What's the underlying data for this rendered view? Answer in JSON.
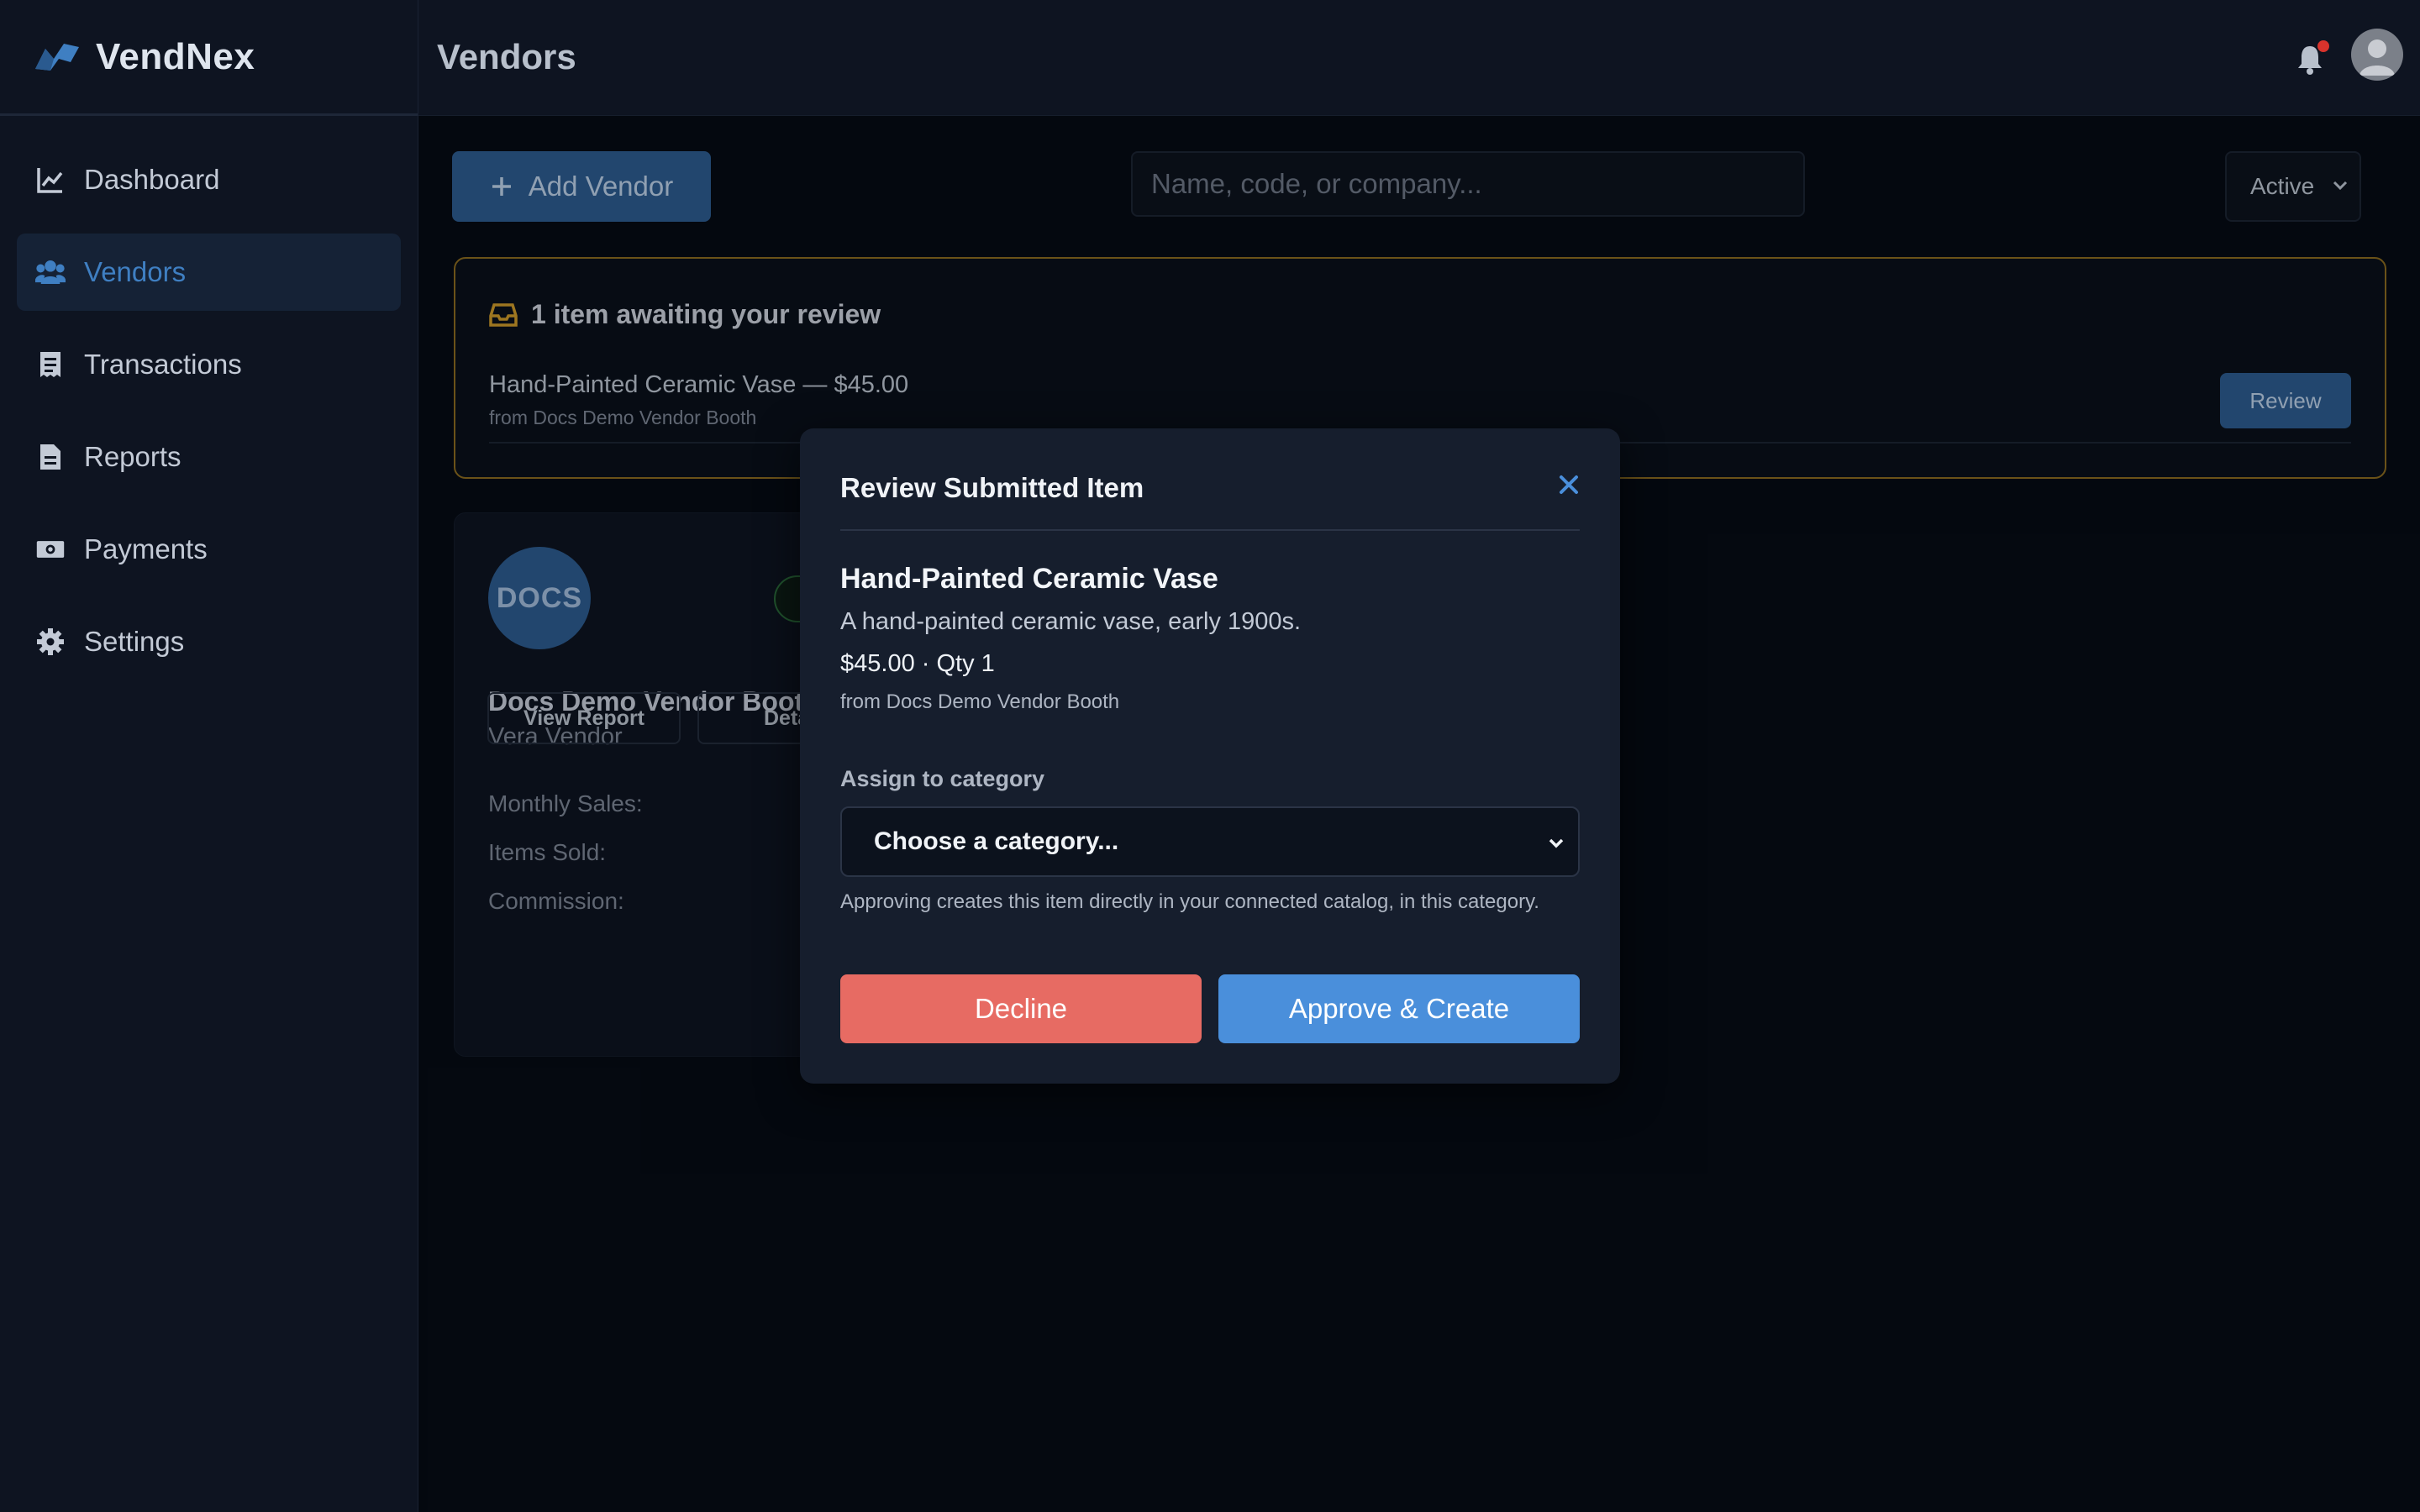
{
  "app": {
    "name": "VendNex"
  },
  "header": {
    "title": "Vendors"
  },
  "sidebar": {
    "items": [
      {
        "label": "Dashboard",
        "icon": "chart-line-icon",
        "active": false
      },
      {
        "label": "Vendors",
        "icon": "users-icon",
        "active": true
      },
      {
        "label": "Transactions",
        "icon": "receipt-icon",
        "active": false
      },
      {
        "label": "Reports",
        "icon": "document-icon",
        "active": false
      },
      {
        "label": "Payments",
        "icon": "money-icon",
        "active": false
      },
      {
        "label": "Settings",
        "icon": "gear-icon",
        "active": false
      }
    ]
  },
  "toolbar": {
    "add_label": "Add Vendor",
    "search_placeholder": "Name, code, or company...",
    "status_value": "Active"
  },
  "review_panel": {
    "heading": "1 item awaiting your review",
    "item_title": "Hand-Painted Ceramic Vase — $45.00",
    "item_from": "from Docs Demo Vendor Booth",
    "review_label": "Review"
  },
  "vendor_card": {
    "logo_text": "DOCS",
    "name": "Docs Demo Vendor Booth",
    "owner": "Vera Vendor",
    "stats": [
      "Monthly Sales:",
      "Items Sold:",
      "Commission:"
    ],
    "view_report_label": "View Report",
    "details_label": "Details"
  },
  "modal": {
    "title": "Review Submitted Item",
    "item_name": "Hand-Painted Ceramic Vase",
    "item_desc": "A hand-painted ceramic vase, early 1900s.",
    "item_price": "$45.00 · Qty 1",
    "item_from": "from Docs Demo Vendor Booth",
    "category_label": "Assign to category",
    "category_placeholder": "Choose a category...",
    "category_help": "Approving creates this item directly in your connected catalog, in this category.",
    "decline_label": "Decline",
    "approve_label": "Approve & Create"
  },
  "colors": {
    "accent": "#4a8fdb",
    "decline": "#e76b63",
    "review_border": "#8a6a1f",
    "notification": "#d8332c"
  }
}
